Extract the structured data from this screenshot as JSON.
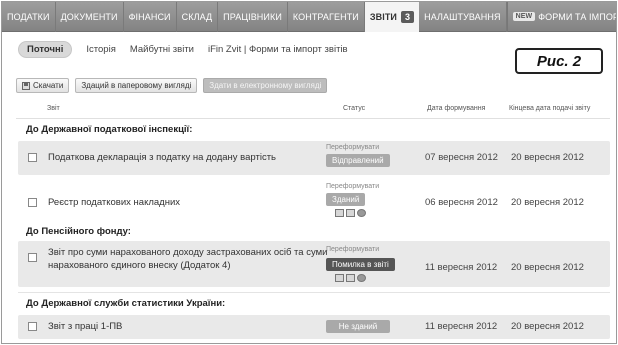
{
  "topnav": {
    "items": [
      "ПОДАТКИ",
      "ДОКУМЕНТИ",
      "ФІНАНСИ",
      "СКЛАД",
      "ПРАЦІВНИКИ",
      "КОНТРАГЕНТИ",
      "ЗВІТИ",
      "НАЛАШТУВАННЯ"
    ],
    "reports_count": "3",
    "new_badge": "NEW",
    "forms_import": "ФОРМИ ТА ІМПОРТ ЗВІТ"
  },
  "subtabs": [
    "Поточні",
    "Історія",
    "Майбутні звіти",
    "iFin Zvit | Форми та імпорт звітів"
  ],
  "figure_label": "Рис. 2",
  "toolbar": {
    "save": "Скачати",
    "paper": "Здаций в паперовому вигляді",
    "electronic": "Здати в електронному вигляді"
  },
  "columns": {
    "report": "Звіт",
    "status": "Статус",
    "formed": "Дата формування",
    "deadline": "Кінцева дата подачі звіту"
  },
  "sections": [
    "До Державної податкової інспекції:",
    "До Пенсійного фонду:",
    "До Державної служби статистики України:"
  ],
  "rows": [
    {
      "name": "Податкова декларація з податку на додану вартість",
      "reform": "Переформувати",
      "status": "Відправлений",
      "formed": "07 вересня 2012",
      "deadline": "20 вересня 2012"
    },
    {
      "name": "Реєстр податкових накладних",
      "reform": "Переформувати",
      "status": "Зданий",
      "formed": "06 вересня 2012",
      "deadline": "20 вересня 2012"
    },
    {
      "name_line1": "Звіт про суми нарахованого доходу застрахованих осіб та суми",
      "name_line2": "нарахованого єдиного внеску (Додаток 4)",
      "reform": "Переформувати",
      "status": "Помилка в звіті",
      "formed": "11 вересня 2012",
      "deadline": "20 вересня 2012"
    },
    {
      "name": "Звіт з праці 1-ПВ",
      "status": "Не зданий",
      "formed": "11 вересня 2012",
      "deadline": "20 вересня 2012"
    }
  ],
  "colors": {
    "nav_bg": "#8f8f8f",
    "row_shade": "#e9e9e9",
    "error_status": "#555555"
  }
}
